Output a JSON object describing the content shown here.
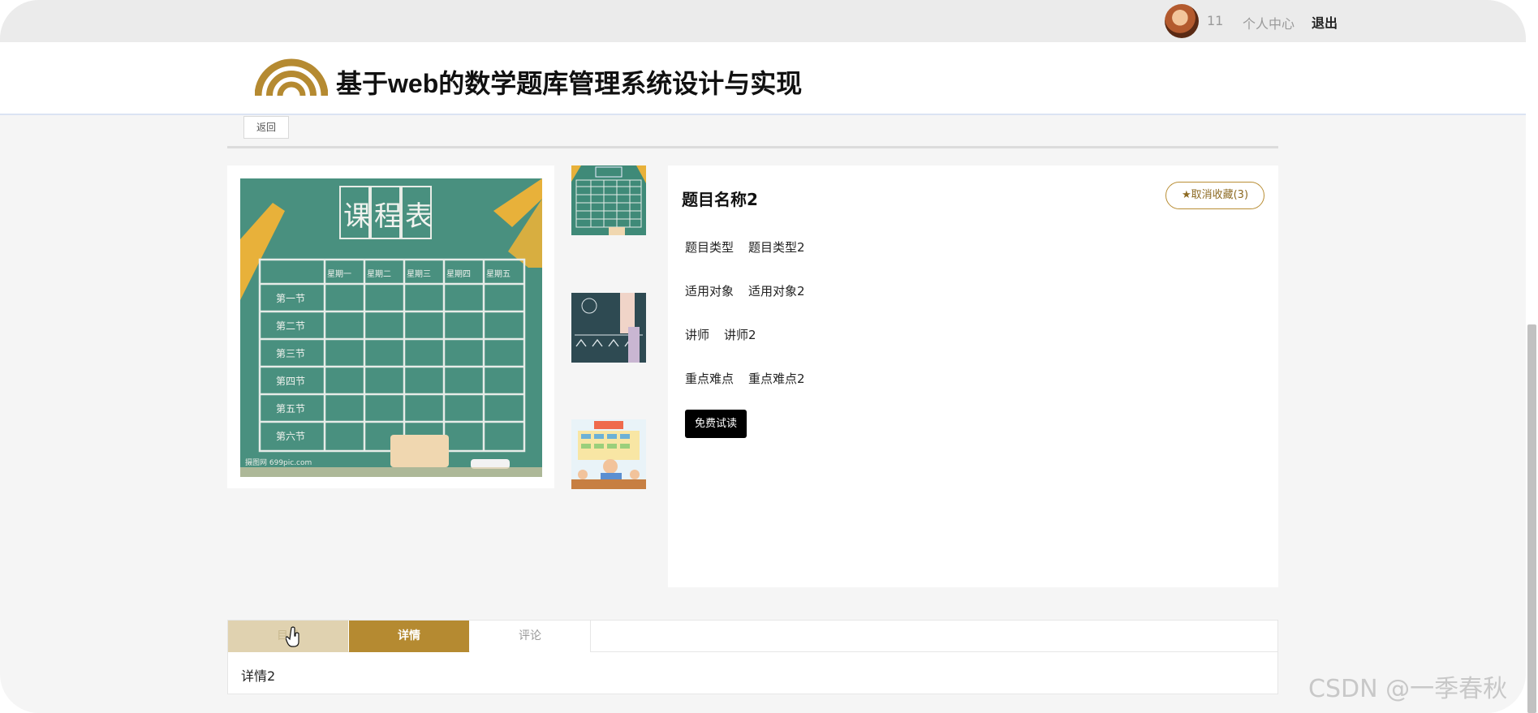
{
  "topbar": {
    "username": "11",
    "personal_center": "个人中心",
    "logout": "退出"
  },
  "header": {
    "site_title": "基于web的数学题库管理系统设计与实现",
    "brand_color": "#b58a31"
  },
  "back_button": "返回",
  "gallery": {
    "main_image": {
      "title": "课程表",
      "weekdays": [
        "星期一",
        "星期二",
        "星期三",
        "星期四",
        "星期五"
      ],
      "periods": [
        "第一节",
        "第二节",
        "第三节",
        "第四节",
        "第五节",
        "第六节"
      ],
      "credit": "摄图网 699pic.com"
    },
    "thumbnails": [
      "schedule-thumb",
      "chalkboard-thumb",
      "cartoon-class-thumb"
    ]
  },
  "item": {
    "title": "题目名称2",
    "favorite_button": "取消收藏(3)",
    "fields": [
      {
        "label": "题目类型",
        "value": "题目类型2"
      },
      {
        "label": "适用对象",
        "value": "适用对象2"
      },
      {
        "label": "讲师",
        "value": "讲师2"
      },
      {
        "label": "重点难点",
        "value": "重点难点2"
      }
    ],
    "trial_button": "免费试读"
  },
  "tabs": [
    "目录",
    "详情",
    "评论"
  ],
  "active_tab": "详情",
  "tab_content": "详情2",
  "watermark": "CSDN @一季春秋"
}
